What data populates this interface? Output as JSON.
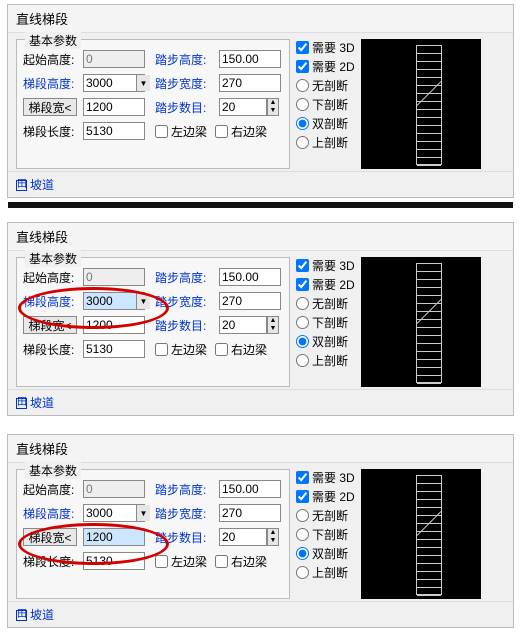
{
  "shared": {
    "panel_title": "直线梯段",
    "group_title": "基本参数",
    "labels": {
      "start_h": "起始高度:",
      "seg_h": "梯段高度:",
      "seg_w": "梯段宽<",
      "seg_len": "梯段长度:",
      "step_h": "踏步高度:",
      "step_w": "踏步宽度:",
      "step_n": "踏步数目:",
      "left_beam": "左边梁",
      "right_beam": "右边梁",
      "need3d": "需要 3D",
      "need2d": "需要 2D",
      "cut_none": "无剖断",
      "cut_down": "下剖断",
      "cut_both": "双剖断",
      "cut_up": "上剖断",
      "ramp_link": "坡道"
    },
    "icons": {
      "expand_box": "田"
    }
  },
  "panels": [
    {
      "start_h": "0",
      "seg_h": "3000",
      "seg_w": "1200",
      "seg_len": "5130",
      "step_h": "150.00",
      "step_w": "270",
      "step_n": "20",
      "hl": null
    },
    {
      "start_h": "0",
      "seg_h": "3000",
      "seg_w": "1200",
      "seg_len": "5130",
      "step_h": "150.00",
      "step_w": "270",
      "step_n": "20",
      "hl": "seg_h"
    },
    {
      "start_h": "0",
      "seg_h": "3000",
      "seg_w": "1200",
      "seg_len": "5130",
      "step_h": "150.00",
      "step_w": "270",
      "step_n": "20",
      "hl": "seg_w"
    }
  ]
}
